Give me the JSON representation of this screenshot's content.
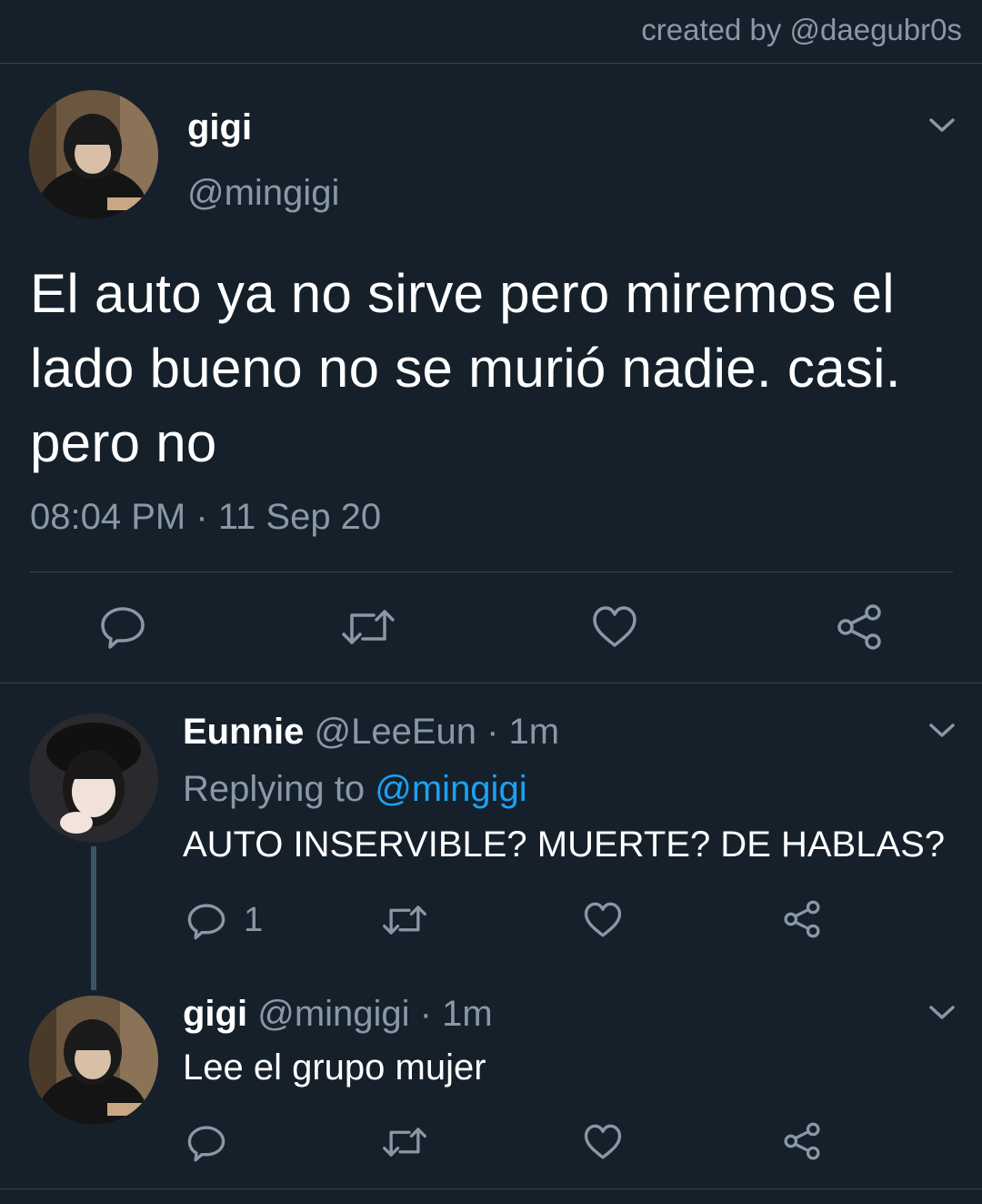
{
  "credit": "created by @daegubr0s",
  "main_tweet": {
    "name": "gigi",
    "handle": "@mingigi",
    "text_lines": [
      "El auto ya no sirve pero miremos el",
      "lado bueno no se murió nadie. casi.",
      "pero no"
    ],
    "timestamp": "08:04 PM · 11 Sep 20",
    "actions": [
      "reply-icon",
      "retweet-icon",
      "like-icon",
      "share-icon"
    ]
  },
  "reply1": {
    "name": "Eunnie",
    "handle": "@LeeEun",
    "time": "· 1m",
    "replying_prefix": "Replying to",
    "replying_to": "@mingigi",
    "text": "AUTO INSERVIBLE? MUERTE? DE HABLAS?",
    "reply_count": "1"
  },
  "reply2": {
    "name": "gigi",
    "handle": "@mingigi",
    "time": "· 1m",
    "text": "Lee el grupo mujer"
  },
  "colors": {
    "background": "#15202b",
    "muted": "#8899a6",
    "link": "#1da1f2",
    "divider": "#38444d"
  }
}
